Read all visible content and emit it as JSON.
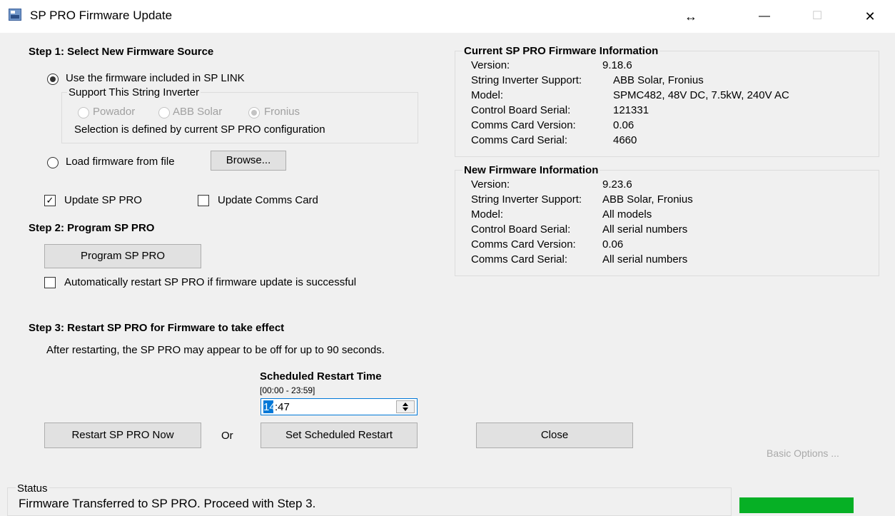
{
  "window": {
    "title": "SP PRO Firmware Update",
    "resize_glyph": "↔",
    "minimize_glyph": "—",
    "maximize_glyph": "☐",
    "close_glyph": "✕"
  },
  "step1": {
    "heading": "Step 1: Select New Firmware Source",
    "use_included_label": "Use the firmware included in SP LINK",
    "support_group_label": "Support This String Inverter",
    "inverters": [
      "Powador",
      "ABB Solar",
      "Fronius"
    ],
    "selection_note": "Selection is defined by current SP PRO configuration",
    "load_file_label": "Load firmware from file",
    "browse_label": "Browse...",
    "update_sp_pro_label": "Update SP PRO",
    "update_comms_label": "Update Comms Card"
  },
  "step2": {
    "heading": "Step 2: Program SP PRO",
    "program_button": "Program SP PRO",
    "auto_restart_label": "Automatically restart SP PRO if firmware update is successful"
  },
  "step3": {
    "heading": "Step 3: Restart SP PRO for Firmware to take effect",
    "note": "After restarting, the SP PRO may appear to be off for up to 90 seconds.",
    "scheduled_title": "Scheduled Restart Time",
    "scheduled_range": "[00:00 - 23:59]",
    "time_hours": "14",
    "time_rest": ":47",
    "restart_now": "Restart SP PRO Now",
    "or": "Or",
    "set_scheduled": "Set Scheduled Restart",
    "close": "Close"
  },
  "current_info": {
    "title": "Current SP PRO Firmware Information",
    "rows": [
      {
        "label": "Version:",
        "value": "9.18.6"
      },
      {
        "label": "String Inverter Support:",
        "value": "ABB Solar, Fronius"
      },
      {
        "label": "Model:",
        "value": "SPMC482, 48V DC, 7.5kW, 240V AC"
      },
      {
        "label": "Control Board Serial:",
        "value": "121331"
      },
      {
        "label": "Comms Card Version:",
        "value": "0.06"
      },
      {
        "label": "Comms Card Serial:",
        "value": "4660"
      }
    ]
  },
  "new_info": {
    "title": "New Firmware Information",
    "rows": [
      {
        "label": "Version:",
        "value": "9.23.6"
      },
      {
        "label": "String Inverter Support:",
        "value": "ABB Solar, Fronius"
      },
      {
        "label": "Model:",
        "value": "All models"
      },
      {
        "label": "Control Board Serial:",
        "value": "All serial numbers"
      },
      {
        "label": "Comms Card Version:",
        "value": "0.06"
      },
      {
        "label": "Comms Card Serial:",
        "value": "All serial numbers"
      }
    ]
  },
  "basic_options": "Basic Options ...",
  "status": {
    "label": "Status",
    "message": "Firmware Transferred to SP PRO.  Proceed with Step 3.",
    "progress_color": "#06b025"
  },
  "state": {
    "use_included": true,
    "load_file": false,
    "inverter_selected": "Fronius",
    "update_sp_pro": true,
    "update_comms": false,
    "auto_restart": false
  }
}
